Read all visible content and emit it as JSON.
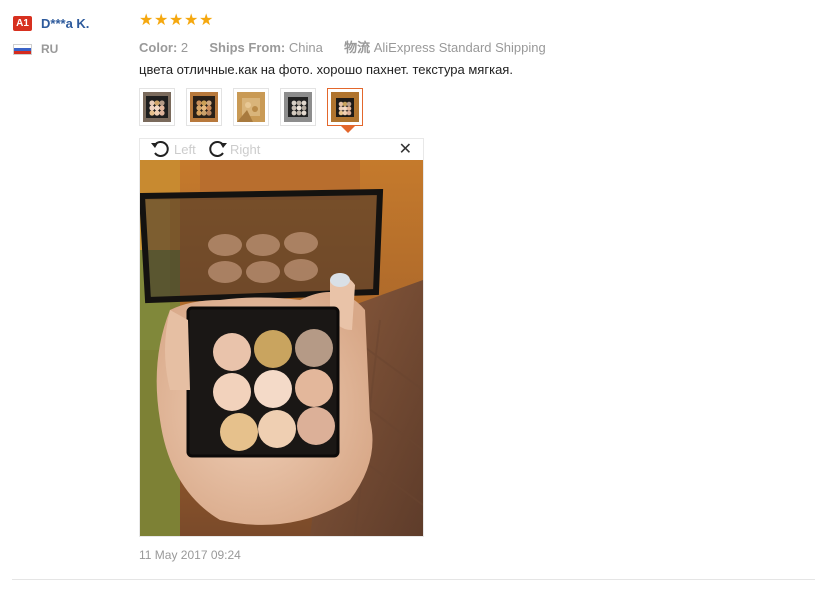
{
  "reviewer": {
    "level_badge": "A1",
    "name": "D***a K.",
    "country": "RU",
    "flag_icon": "russia-flag-icon"
  },
  "rating": {
    "stars": 5,
    "max": 5,
    "star_icon": "star-icon",
    "color": "#f5a80f"
  },
  "meta": {
    "color_label": "Color:",
    "color_value": "2",
    "ships_label": "Ships From:",
    "ships_value": "China",
    "logistics_label": "物流",
    "logistics_value": "AliExpress Standard Shipping"
  },
  "review_text": "цвета отличные.как на фото. хорошо пахнет. текстура мягкая.",
  "thumbnails": {
    "count": 5,
    "active_index": 4
  },
  "viewer": {
    "rotate_left_label": "Left",
    "rotate_right_label": "Right",
    "close_icon": "close-icon"
  },
  "date": "11 May 2017 09:24",
  "colors": {
    "accent": "#e3672c",
    "name_link": "#2d5a9c",
    "badge": "#d7301f"
  }
}
